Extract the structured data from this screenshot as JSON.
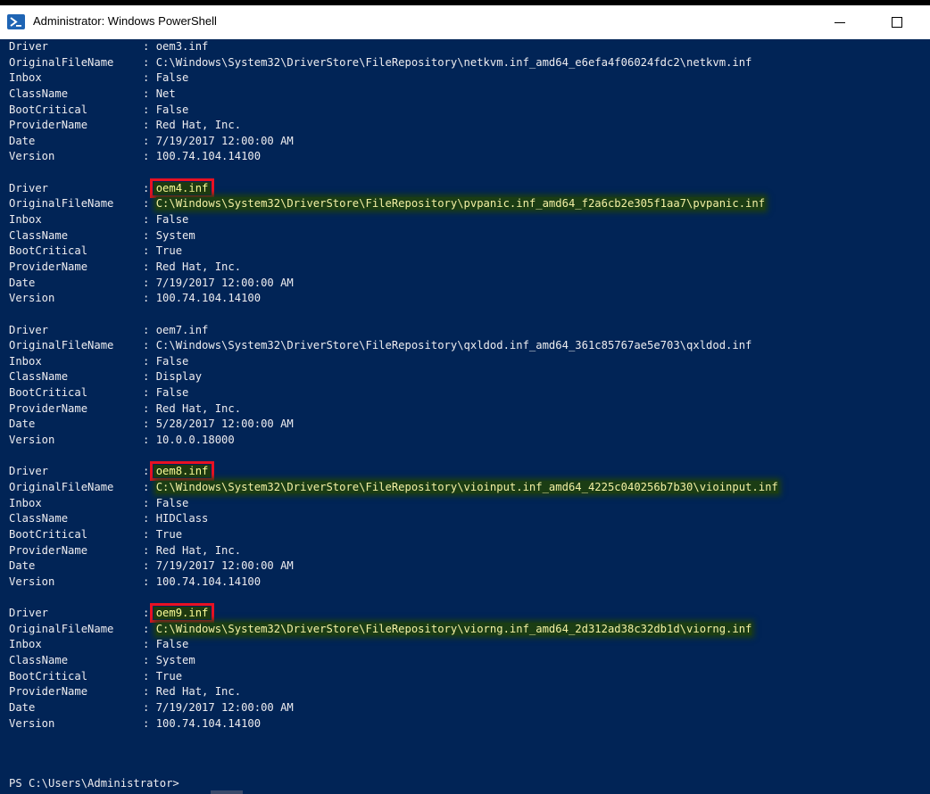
{
  "window": {
    "title": "Administrator: Windows PowerShell",
    "icon": "powershell-icon"
  },
  "records": [
    {
      "highlight": false,
      "fields": [
        {
          "key": "Driver",
          "value": "oem3.inf"
        },
        {
          "key": "OriginalFileName",
          "value": "C:\\Windows\\System32\\DriverStore\\FileRepository\\netkvm.inf_amd64_e6efa4f06024fdc2\\netkvm.inf"
        },
        {
          "key": "Inbox",
          "value": "False"
        },
        {
          "key": "ClassName",
          "value": "Net"
        },
        {
          "key": "BootCritical",
          "value": "False"
        },
        {
          "key": "ProviderName",
          "value": "Red Hat, Inc."
        },
        {
          "key": "Date",
          "value": "7/19/2017 12:00:00 AM"
        },
        {
          "key": "Version",
          "value": "100.74.104.14100"
        }
      ]
    },
    {
      "highlight": true,
      "fields": [
        {
          "key": "Driver",
          "value": "oem4.inf"
        },
        {
          "key": "OriginalFileName",
          "value": "C:\\Windows\\System32\\DriverStore\\FileRepository\\pvpanic.inf_amd64_f2a6cb2e305f1aa7\\pvpanic.inf"
        },
        {
          "key": "Inbox",
          "value": "False"
        },
        {
          "key": "ClassName",
          "value": "System"
        },
        {
          "key": "BootCritical",
          "value": "True"
        },
        {
          "key": "ProviderName",
          "value": "Red Hat, Inc."
        },
        {
          "key": "Date",
          "value": "7/19/2017 12:00:00 AM"
        },
        {
          "key": "Version",
          "value": "100.74.104.14100"
        }
      ]
    },
    {
      "highlight": false,
      "fields": [
        {
          "key": "Driver",
          "value": "oem7.inf"
        },
        {
          "key": "OriginalFileName",
          "value": "C:\\Windows\\System32\\DriverStore\\FileRepository\\qxldod.inf_amd64_361c85767ae5e703\\qxldod.inf"
        },
        {
          "key": "Inbox",
          "value": "False"
        },
        {
          "key": "ClassName",
          "value": "Display"
        },
        {
          "key": "BootCritical",
          "value": "False"
        },
        {
          "key": "ProviderName",
          "value": "Red Hat, Inc."
        },
        {
          "key": "Date",
          "value": "5/28/2017 12:00:00 AM"
        },
        {
          "key": "Version",
          "value": "10.0.0.18000"
        }
      ]
    },
    {
      "highlight": true,
      "fields": [
        {
          "key": "Driver",
          "value": "oem8.inf"
        },
        {
          "key": "OriginalFileName",
          "value": "C:\\Windows\\System32\\DriverStore\\FileRepository\\vioinput.inf_amd64_4225c040256b7b30\\vioinput.inf"
        },
        {
          "key": "Inbox",
          "value": "False"
        },
        {
          "key": "ClassName",
          "value": "HIDClass"
        },
        {
          "key": "BootCritical",
          "value": "True"
        },
        {
          "key": "ProviderName",
          "value": "Red Hat, Inc."
        },
        {
          "key": "Date",
          "value": "7/19/2017 12:00:00 AM"
        },
        {
          "key": "Version",
          "value": "100.74.104.14100"
        }
      ]
    },
    {
      "highlight": true,
      "fields": [
        {
          "key": "Driver",
          "value": "oem9.inf"
        },
        {
          "key": "OriginalFileName",
          "value": "C:\\Windows\\System32\\DriverStore\\FileRepository\\viorng.inf_amd64_2d312ad38c32db1d\\viorng.inf"
        },
        {
          "key": "Inbox",
          "value": "False"
        },
        {
          "key": "ClassName",
          "value": "System"
        },
        {
          "key": "BootCritical",
          "value": "True"
        },
        {
          "key": "ProviderName",
          "value": "Red Hat, Inc."
        },
        {
          "key": "Date",
          "value": "7/19/2017 12:00:00 AM"
        },
        {
          "key": "Version",
          "value": "100.74.104.14100"
        }
      ]
    }
  ],
  "prompt": "PS C:\\Users\\Administrator>",
  "colors": {
    "console_bg": "#012456",
    "console_fg": "#eeedf0",
    "highlight_box": "#e81123",
    "highlight_text": "#f3f0a4"
  }
}
